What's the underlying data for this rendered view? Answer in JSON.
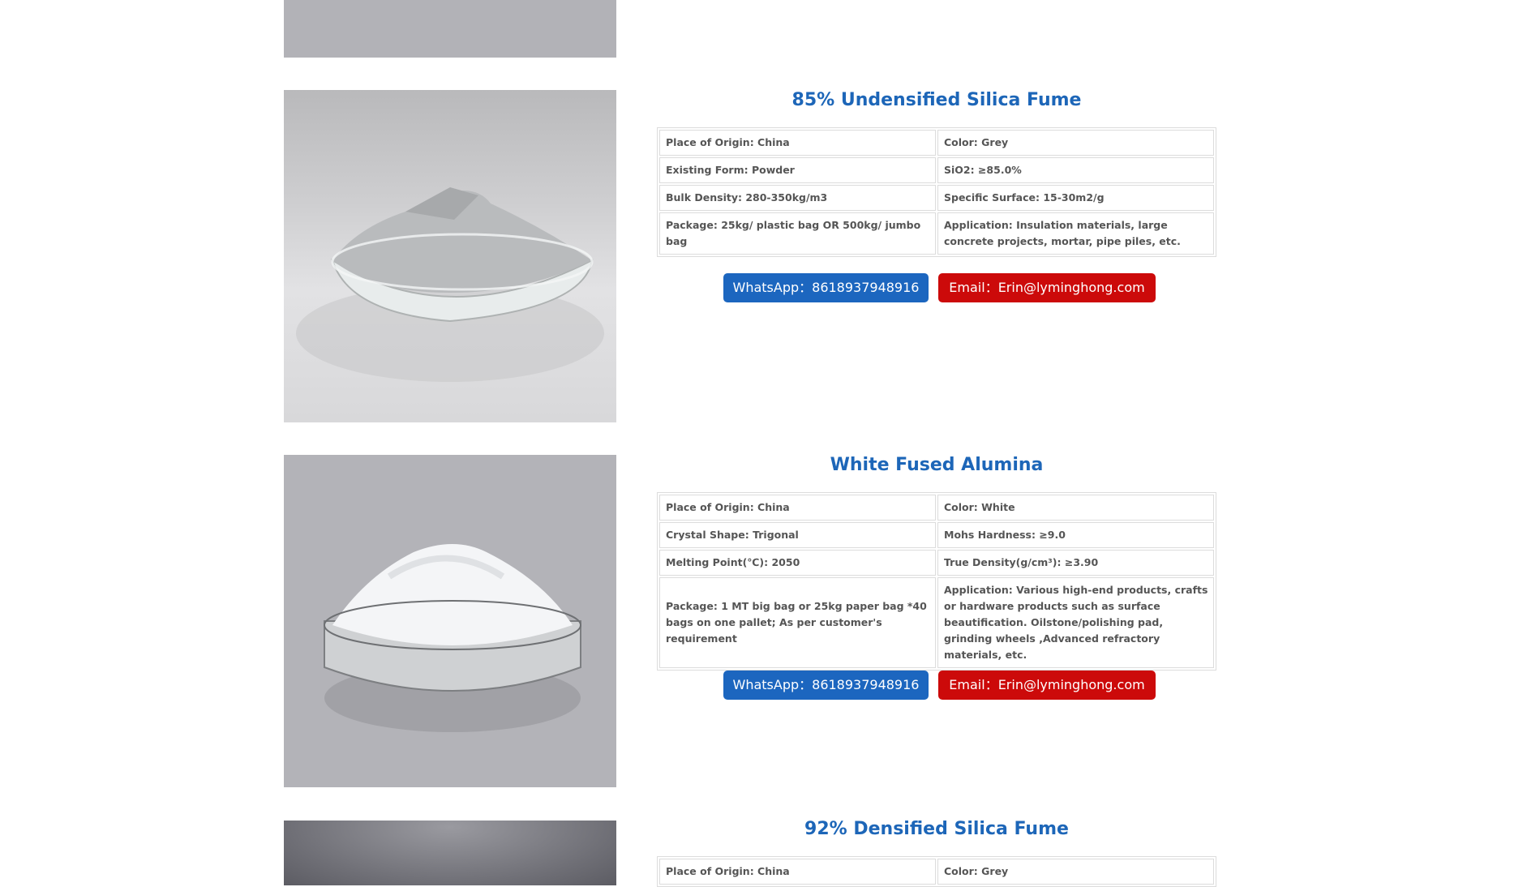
{
  "whatsapp_label": "WhatsApp：8618937948916",
  "email_label": "Email：Erin@lyminghong.com",
  "products": [
    {
      "title": "85% Undensified Silica Fume",
      "specs": [
        [
          "Place of Origin: China",
          "Color: Grey"
        ],
        [
          "Existing Form: Powder",
          "SiO2: ≥85.0%"
        ],
        [
          "Bulk Density: 280-350kg/m3",
          "Specific Surface: 15-30m2/g"
        ],
        [
          "Package: 25kg/ plastic bag OR 500kg/ jumbo bag",
          "Application: Insulation materials, large concrete projects, mortar, pipe piles, etc."
        ]
      ]
    },
    {
      "title": "White Fused Alumina",
      "specs": [
        [
          "Place of Origin: China",
          "Color: White"
        ],
        [
          "Crystal Shape: Trigonal",
          "Mohs Hardness: ≥9.0"
        ],
        [
          "Melting Point(℃): 2050",
          "True Density(g/cm³): ≥3.90"
        ],
        [
          "Package: 1 MT big bag or 25kg paper bag *40 bags on one pallet; As per customer's requirement",
          "Application: Various high-end products, crafts or hardware products such as surface beautification. Oilstone/polishing pad, grinding wheels ,Advanced refractory materials, etc."
        ]
      ]
    },
    {
      "title": "92% Densified Silica Fume",
      "specs": [
        [
          "Place of Origin: China",
          "Color: Grey"
        ]
      ]
    }
  ]
}
